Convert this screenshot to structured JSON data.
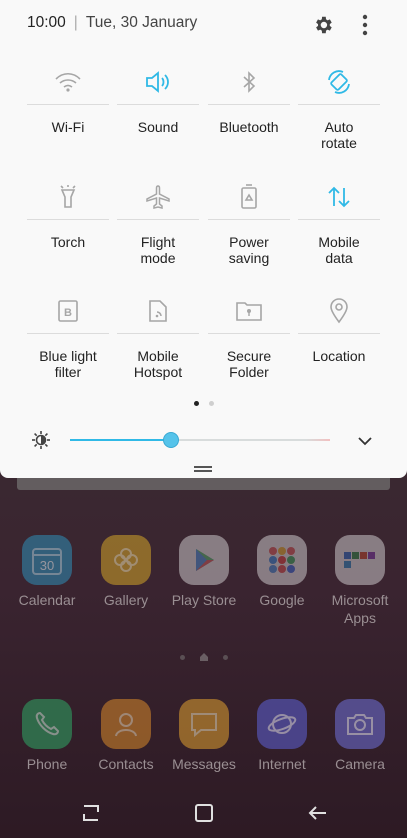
{
  "status_bar": {
    "time": "10:00",
    "date": "Tue, 30 January"
  },
  "quick_tiles": [
    {
      "label": "Wi-Fi",
      "icon": "wifi-icon",
      "active": false
    },
    {
      "label": "Sound",
      "icon": "sound-icon",
      "active": true
    },
    {
      "label": "Bluetooth",
      "icon": "bluetooth-icon",
      "active": false
    },
    {
      "label": "Auto\nrotate",
      "icon": "auto-rotate-icon",
      "active": true
    },
    {
      "label": "Torch",
      "icon": "torch-icon",
      "active": false
    },
    {
      "label": "Flight\nmode",
      "icon": "airplane-icon",
      "active": false
    },
    {
      "label": "Power\nsaving",
      "icon": "battery-icon",
      "active": false
    },
    {
      "label": "Mobile\ndata",
      "icon": "mobile-data-icon",
      "active": true
    },
    {
      "label": "Blue light\nfilter",
      "icon": "blue-light-icon",
      "active": false
    },
    {
      "label": "Mobile\nHotspot",
      "icon": "hotspot-icon",
      "active": false
    },
    {
      "label": "Secure\nFolder",
      "icon": "secure-folder-icon",
      "active": false
    },
    {
      "label": "Location",
      "icon": "location-icon",
      "active": false
    }
  ],
  "brightness": {
    "level": 0.39,
    "auto": false
  },
  "quick_panel_page": {
    "current": 1,
    "total": 2
  },
  "home_apps": [
    {
      "label": "Calendar",
      "icon": "calendar-icon",
      "badge_text": "30",
      "color": "#2f8fb8"
    },
    {
      "label": "Gallery",
      "icon": "gallery-icon",
      "color": "#d2a428"
    },
    {
      "label": "Play Store",
      "icon": "play-store-icon",
      "color": "#e8e8e8"
    },
    {
      "label": "Google",
      "icon": "google-folder-icon",
      "color": "#e8e8e8"
    },
    {
      "label": "Microsoft\nApps",
      "icon": "microsoft-folder-icon",
      "color": "#e8e8e8"
    },
    {
      "label": "Phone",
      "icon": "phone-icon",
      "color": "#2fa865"
    },
    {
      "label": "Contacts",
      "icon": "contacts-icon",
      "color": "#d98a2a"
    },
    {
      "label": "Messages",
      "icon": "messages-icon",
      "color": "#e0a030"
    },
    {
      "label": "Internet",
      "icon": "internet-icon",
      "color": "#5a5cc8"
    },
    {
      "label": "Camera",
      "icon": "camera-icon",
      "color": "#6a6acc"
    }
  ],
  "colors": {
    "accent": "#30b9e6",
    "panel_bg": "#f9f9f9",
    "icon_inactive": "#a6a6a6"
  }
}
